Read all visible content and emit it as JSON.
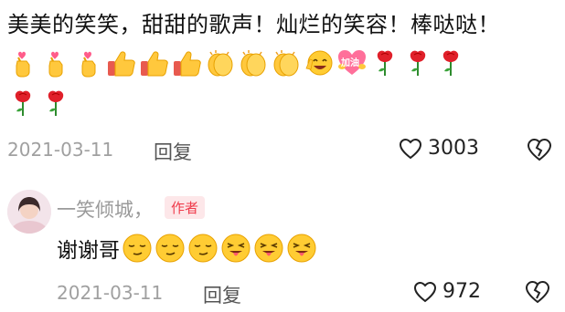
{
  "comment": {
    "text": "美美的笑笑，甜甜的歌声！灿烂的笑容！棒哒哒！",
    "emoji_row_1": [
      "finger-heart-icon",
      "finger-heart-icon",
      "finger-heart-icon",
      "thumbs-up-icon",
      "thumbs-up-icon",
      "thumbs-up-icon",
      "clapping-hands-icon",
      "clapping-hands-icon",
      "clapping-hands-icon",
      "grinning-victory-icon",
      "cheer-heart-icon",
      "rose-icon",
      "rose-icon",
      "rose-icon"
    ],
    "emoji_row_2": [
      "rose-icon",
      "rose-icon"
    ],
    "cheer_label": "加油",
    "date": "2021-03-11",
    "reply_label": "回复",
    "like_count": "3003"
  },
  "reply": {
    "author": "一笑倾城，",
    "author_badge": "作者",
    "text": "谢谢哥",
    "emojis": [
      "smirk-face-icon",
      "smirk-face-icon",
      "smirk-face-icon",
      "tongue-wink-face-icon",
      "tongue-wink-face-icon",
      "tongue-wink-face-icon"
    ],
    "date": "2021-03-11",
    "reply_label": "回复",
    "like_count": "972"
  },
  "colors": {
    "accent_red": "#ef3b4b",
    "meta_gray": "#a0a0a0",
    "emoji_yellow": "#ffcc33",
    "rose_red": "#e0202a"
  }
}
